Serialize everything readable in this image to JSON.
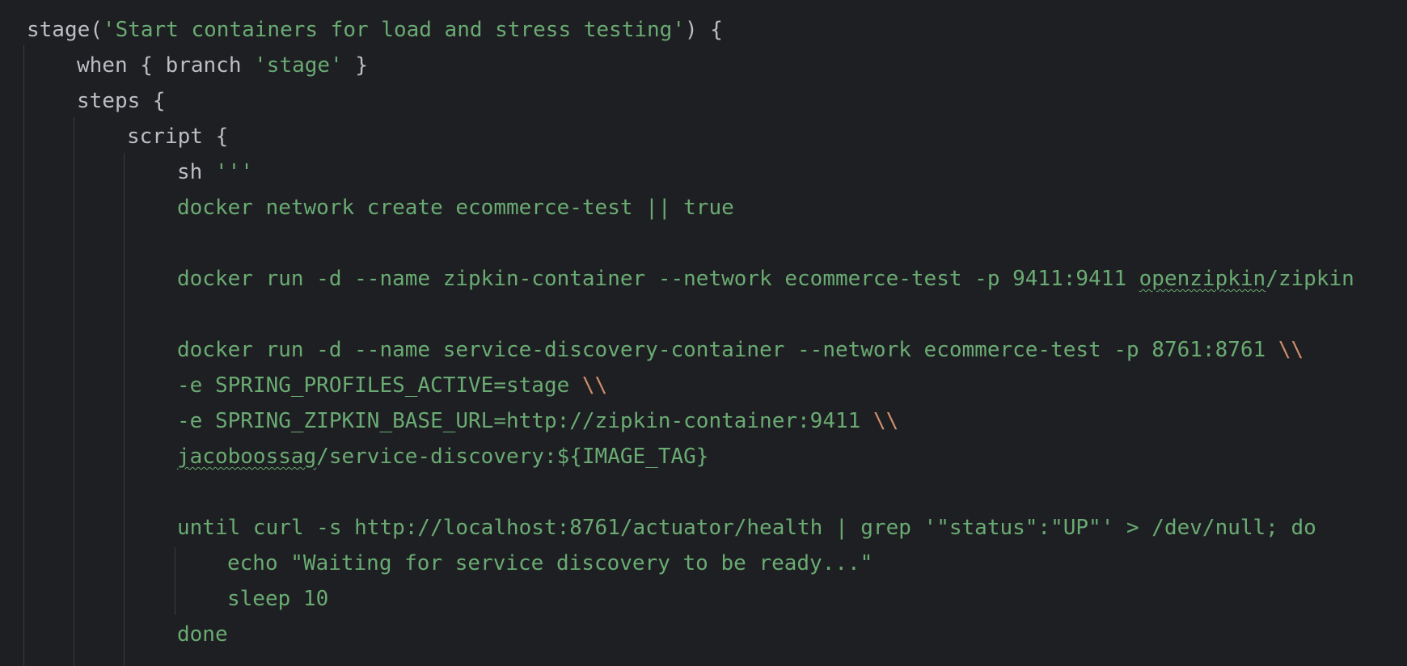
{
  "editor": {
    "theme": {
      "background": "#1e1f22",
      "plain": "#bcbec4",
      "string": "#6aab73",
      "escape": "#cf8e6d",
      "guide": "#393b40"
    },
    "lines": [
      {
        "indent": 0,
        "tokens": [
          {
            "t": "stage(",
            "k": "plain"
          },
          {
            "t": "'Start containers for load and stress testing'",
            "k": "string"
          },
          {
            "t": ") {",
            "k": "plain"
          }
        ]
      },
      {
        "indent": 1,
        "tokens": [
          {
            "t": "when { branch ",
            "k": "plain"
          },
          {
            "t": "'stage'",
            "k": "string"
          },
          {
            "t": " }",
            "k": "plain"
          }
        ]
      },
      {
        "indent": 1,
        "tokens": [
          {
            "t": "steps {",
            "k": "plain"
          }
        ]
      },
      {
        "indent": 2,
        "tokens": [
          {
            "t": "script {",
            "k": "plain"
          }
        ]
      },
      {
        "indent": 3,
        "tokens": [
          {
            "t": "sh ",
            "k": "plain"
          },
          {
            "t": "'''",
            "k": "string"
          }
        ]
      },
      {
        "indent": 3,
        "tokens": [
          {
            "t": "docker network create ecommerce-test || true",
            "k": "string"
          }
        ]
      },
      {
        "indent": 3,
        "tokens": []
      },
      {
        "indent": 3,
        "tokens": [
          {
            "t": "docker run -d --name zipkin-container --network ecommerce-test -p 9411:9411 ",
            "k": "string"
          },
          {
            "t": "openzipkin",
            "k": "string",
            "u": true
          },
          {
            "t": "/zipkin",
            "k": "string"
          }
        ]
      },
      {
        "indent": 3,
        "tokens": []
      },
      {
        "indent": 3,
        "tokens": [
          {
            "t": "docker run -d --name service-discovery-container --network ecommerce-test -p 8761:8761 ",
            "k": "string"
          },
          {
            "t": "\\\\",
            "k": "escape"
          }
        ]
      },
      {
        "indent": 3,
        "tokens": [
          {
            "t": "-e SPRING_PROFILES_ACTIVE=stage ",
            "k": "string"
          },
          {
            "t": "\\\\",
            "k": "escape"
          }
        ]
      },
      {
        "indent": 3,
        "tokens": [
          {
            "t": "-e SPRING_ZIPKIN_BASE_URL=http://zipkin-container:9411 ",
            "k": "string"
          },
          {
            "t": "\\\\",
            "k": "escape"
          }
        ]
      },
      {
        "indent": 3,
        "tokens": [
          {
            "t": "jacoboossag",
            "k": "string",
            "u": true
          },
          {
            "t": "/service-discovery:${IMAGE_TAG}",
            "k": "string"
          }
        ]
      },
      {
        "indent": 3,
        "tokens": []
      },
      {
        "indent": 3,
        "tokens": [
          {
            "t": "until curl -s http://localhost:8761/actuator/health | grep '\"status\":\"UP\"' > /dev/null; do",
            "k": "string"
          }
        ]
      },
      {
        "indent": 4,
        "tokens": [
          {
            "t": "echo \"Waiting for service discovery to be ready...\"",
            "k": "string"
          }
        ]
      },
      {
        "indent": 4,
        "tokens": [
          {
            "t": "sleep 10",
            "k": "string"
          }
        ]
      },
      {
        "indent": 3,
        "tokens": [
          {
            "t": "done",
            "k": "string"
          }
        ]
      }
    ]
  }
}
